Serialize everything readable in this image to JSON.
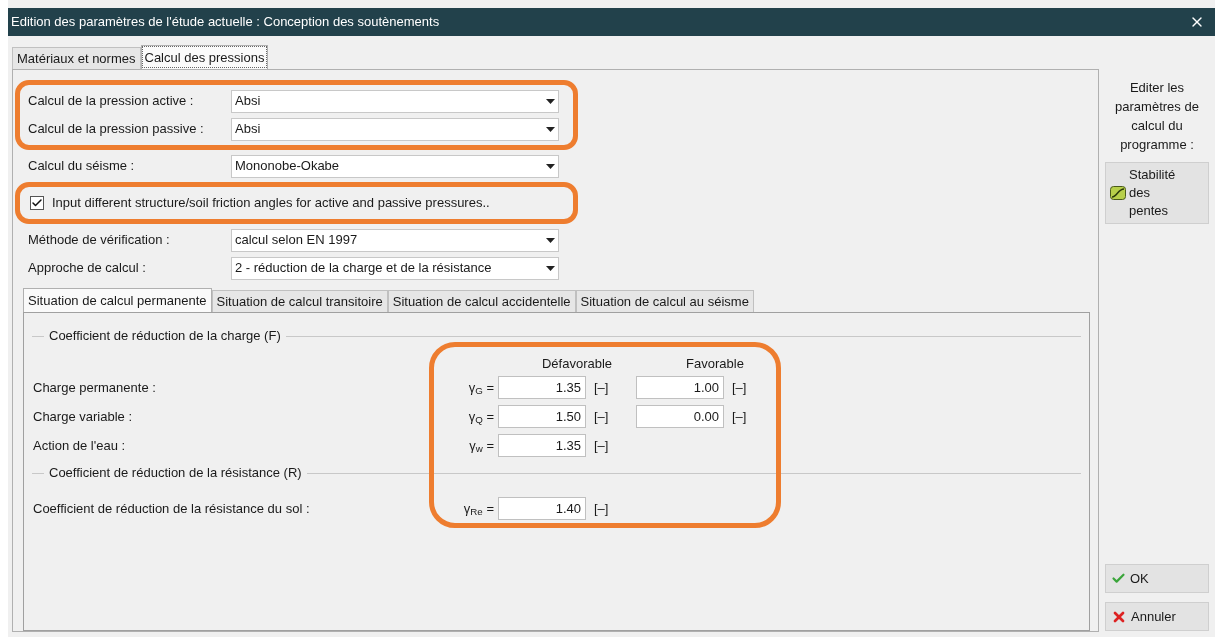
{
  "window": {
    "title": "Edition des paramètres de l'étude actuelle : Conception des soutènements"
  },
  "tabs": [
    {
      "label": "Matériaux et normes",
      "selected": false
    },
    {
      "label": "Calcul des pressions",
      "selected": true
    }
  ],
  "form_groups": [
    {
      "highlighted": true,
      "rows": [
        {
          "kind": "select",
          "label": "Calcul de la pression active :",
          "value": "Absi"
        },
        {
          "kind": "select",
          "label": "Calcul de la pression passive :",
          "value": "Absi"
        }
      ]
    },
    {
      "highlighted": false,
      "rows": [
        {
          "kind": "select",
          "label": "Calcul du séisme :",
          "value": "Mononobe-Okabe"
        }
      ]
    },
    {
      "highlighted": true,
      "rows": [
        {
          "kind": "checkbox",
          "label": "Input different structure/soil friction angles for active and passive pressures..",
          "checked": true
        }
      ]
    },
    {
      "highlighted": false,
      "rows": [
        {
          "kind": "select",
          "label": "Méthode de vérification :",
          "value": "calcul selon EN 1997"
        },
        {
          "kind": "select",
          "label": "Approche de calcul :",
          "value": "2 - réduction de la charge et de la résistance"
        }
      ]
    }
  ],
  "sub_tabs": [
    {
      "label": "Situation de calcul permanente",
      "selected": true
    },
    {
      "label": "Situation de calcul transitoire",
      "selected": false
    },
    {
      "label": "Situation de calcul accidentelle",
      "selected": false
    },
    {
      "label": "Situation de calcul au séisme",
      "selected": false
    }
  ],
  "coefficients": {
    "highlighted": true,
    "sections": [
      {
        "title": "Coefficient de réduction de la charge (F)",
        "columns": [
          "Défavorable",
          "Favorable"
        ],
        "rows": [
          {
            "label": "Charge permanente :",
            "symbol": "γ$_{G}$ =",
            "values": [
              {
                "value": "1.35",
                "unit": "[–]"
              },
              {
                "value": "1.00",
                "unit": "[–]"
              }
            ]
          },
          {
            "label": "Charge variable :",
            "symbol": "γ$_{Q}$ =",
            "values": [
              {
                "value": "1.50",
                "unit": "[–]"
              },
              {
                "value": "0.00",
                "unit": "[–]"
              }
            ]
          },
          {
            "label": "Action de l'eau :",
            "symbol": "γ$_{w}$ =",
            "values": [
              {
                "value": "1.35",
                "unit": "[–]"
              }
            ]
          }
        ]
      },
      {
        "title": "Coefficient de réduction de la résistance (R)",
        "rows": [
          {
            "label": "Coefficient de réduction de la résistance du sol :",
            "symbol": "γ$_{Re}$ =",
            "values": [
              {
                "value": "1.40",
                "unit": "[–]"
              }
            ]
          }
        ]
      }
    ]
  },
  "side": {
    "text": "Editer les paramètres de calcul du programme :",
    "button": "Stabilité des pentes"
  },
  "buttons": [
    {
      "kind": "ok",
      "label": "OK"
    },
    {
      "kind": "cancel",
      "label": "Annuler"
    }
  ]
}
